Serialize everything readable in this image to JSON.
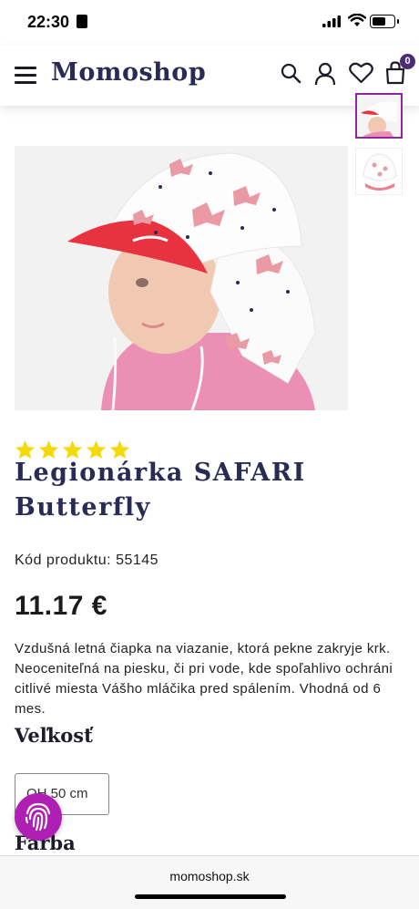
{
  "status_bar": {
    "time": "22:30"
  },
  "header": {
    "logo": "Momoshop",
    "cart_count": "0"
  },
  "product": {
    "rating_stars": 5,
    "title": "Legionárka SAFARI Butterfly",
    "code_label": "Kód produktu: 55145",
    "price": "11.17 €",
    "description": "Vzdušná letná čiapka na viazanie, ktorá pekne zakryje krk. Neoceniteľná na piesku, či pri vode, kde spoľahlivo ochráni citlivé miesta Vášho mláčika pred spálením. Vhodná od 6 mes.",
    "size_label": "Veľkosť",
    "size_option": "OH 50 cm",
    "color_label": "Farba"
  },
  "browser": {
    "url": "momoshop.sk"
  },
  "colors": {
    "brand": "#2a2b55",
    "accent": "#8b2a9b",
    "star": "#f5d90a",
    "cart_badge": "#4b2d73",
    "fab": "#b01fb4"
  },
  "icons": [
    "menu-icon",
    "search-icon",
    "user-icon",
    "heart-icon",
    "cart-icon",
    "fingerprint-icon"
  ]
}
